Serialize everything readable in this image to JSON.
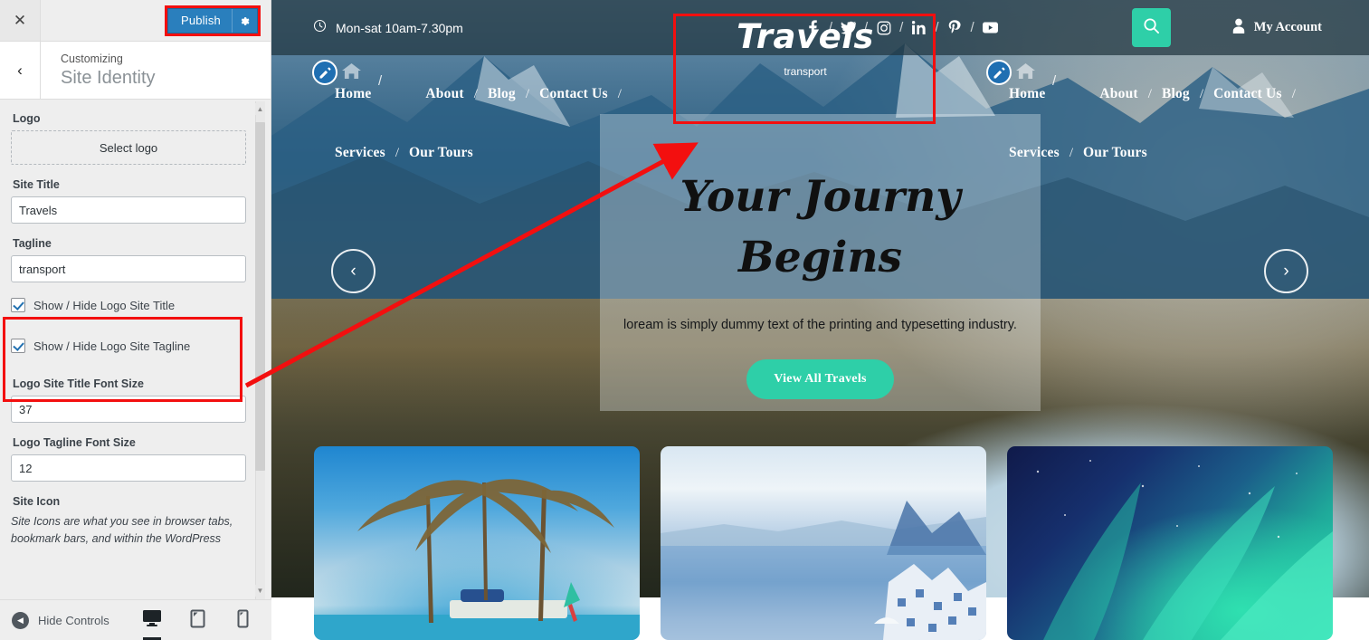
{
  "customizer": {
    "close_icon": "close-icon",
    "publish_label": "Publish",
    "publish_gear_icon": "gear-icon",
    "back_icon": "chevron-left-icon",
    "subtitle": "Customizing",
    "title": "Site Identity",
    "fields": {
      "logo_label": "Logo",
      "select_logo_label": "Select logo",
      "site_title_label": "Site Title",
      "site_title_value": "Travels",
      "tagline_label": "Tagline",
      "tagline_value": "transport",
      "check_title_label": "Show / Hide Logo Site Title",
      "check_tagline_label": "Show / Hide Logo Site Tagline",
      "title_font_label": "Logo Site Title Font Size",
      "title_font_value": "37",
      "tagline_font_label": "Logo Tagline Font Size",
      "tagline_font_value": "12",
      "site_icon_label": "Site Icon",
      "site_icon_note": "Site Icons are what you see in browser tabs, bookmark bars, and within the WordPress"
    },
    "footer": {
      "hide_controls_label": "Hide Controls",
      "devices": [
        {
          "name": "desktop",
          "label": "Desktop",
          "icon": "desktop-icon",
          "active": true
        },
        {
          "name": "tablet",
          "label": "Tablet",
          "icon": "tablet-icon",
          "active": false
        },
        {
          "name": "mobile",
          "label": "Mobile",
          "icon": "mobile-icon",
          "active": false
        }
      ]
    },
    "highlight_color": "#f30f0f"
  },
  "preview": {
    "topbar": {
      "clock_icon": "clock-icon",
      "hours": "Mon-sat 10am-7.30pm",
      "socials": [
        {
          "name": "facebook",
          "glyph": "f"
        },
        {
          "name": "twitter",
          "glyph": "twitter-bird"
        },
        {
          "name": "instagram",
          "glyph": "instagram-camera"
        },
        {
          "name": "linkedin",
          "glyph": "in"
        },
        {
          "name": "pinterest",
          "glyph": "P"
        },
        {
          "name": "youtube",
          "glyph": "youtube-play"
        }
      ],
      "separator": "/",
      "search_icon": "search-icon",
      "account_icon": "user-icon",
      "account_label": "My Account",
      "accent_color": "#2ecfa8"
    },
    "nav": {
      "edit_icon": "pencil-edit-icon",
      "home_icon": "home-icon",
      "row1": [
        "Home",
        "About",
        "Blog",
        "Contact Us"
      ],
      "row2": [
        "Services",
        "Our Tours"
      ],
      "separator": "/"
    },
    "logo": {
      "title": "Travels",
      "tagline": "transport"
    },
    "hero": {
      "heading_line1": "Your Journy",
      "heading_line2": "Begins",
      "paragraph": "loream is simply dummy text of the printing and typesetting industry.",
      "cta_label": "View All Travels",
      "prev_icon": "chevron-left-icon",
      "next_icon": "chevron-right-icon"
    },
    "cards": [
      {
        "name": "card-palms"
      },
      {
        "name": "card-coast"
      },
      {
        "name": "card-aurora"
      }
    ]
  }
}
